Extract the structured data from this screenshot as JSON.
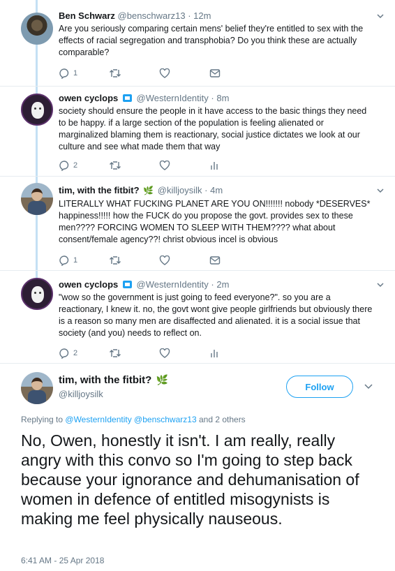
{
  "tweets": [
    {
      "name": "Ben Schwarz",
      "handle": "@benschwarz13",
      "time": "12m",
      "text": "Are you seriously comparing certain mens' belief they're entitled to sex with the effects of racial segregation and transphobia? Do you think these are actually comparable?",
      "replies": "1",
      "verified_badge": false,
      "emoji": ""
    },
    {
      "name": "owen cyclops",
      "handle": "@WesternIdentity",
      "time": "8m",
      "text": "society should ensure the people in it have access to the basic things they need to be happy. if a large section of the population is feeling alienated or marginalized blaming them is reactionary, social justice dictates we look at our culture and see what made them that way",
      "replies": "2",
      "verified_badge": true,
      "emoji": ""
    },
    {
      "name": "tim, with the fitbit?",
      "handle": "@killjoysilk",
      "time": "4m",
      "text": "LITERALLY WHAT FUCKING PLANET ARE YOU ON!!!!!!! nobody *DESERVES* happiness!!!!! how the FUCK do you propose the govt. provides sex to these men???? FORCING WOMEN TO SLEEP WITH THEM???? what about consent/female agency??! christ obvious incel is obvious",
      "replies": "1",
      "verified_badge": false,
      "emoji": "leaf-emoji"
    },
    {
      "name": "owen cyclops",
      "handle": "@WesternIdentity",
      "time": "2m",
      "text": "\"wow so the government is just going to feed everyone?\". so you are a reactionary, I knew it. no, the govt wont give people girlfriends but obviously there is a reason so many men are disaffected and alienated. it is a social issue that society (and you) needs to reflect on.",
      "replies": "2",
      "verified_badge": true,
      "emoji": ""
    }
  ],
  "main_tweet": {
    "name": "tim, with the fitbit?",
    "handle": "@killjoysilk",
    "follow_label": "Follow",
    "replying_prefix": "Replying to",
    "replying_to": "@WesternIdentity @benschwarz13",
    "replying_suffix": "and 2 others",
    "text": "No, Owen, honestly it isn't. I am really, really angry with this convo so I'm going to step back because your ignorance and dehumanisation of women in defence of entitled misogynists is making me feel physically nauseous.",
    "timestamp": "6:41 AM - 25 Apr 2018"
  },
  "colors": {
    "accent": "#1da1f2",
    "muted": "#657786",
    "thread_line": "#c4e0f4"
  }
}
